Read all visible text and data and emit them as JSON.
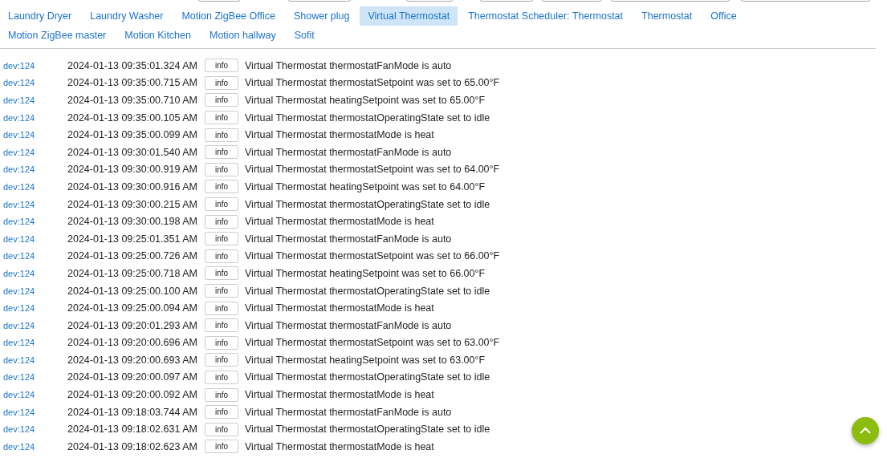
{
  "tabs": [
    {
      "label": "Laundry Dryer",
      "selected": false
    },
    {
      "label": "Laundry Washer",
      "selected": false
    },
    {
      "label": "Motion ZigBee Office",
      "selected": false
    },
    {
      "label": "Shower plug",
      "selected": false
    },
    {
      "label": "Virtual Thermostat",
      "selected": true
    },
    {
      "label": "Thermostat Scheduler: Thermostat",
      "selected": false
    },
    {
      "label": "Thermostat",
      "selected": false
    },
    {
      "label": "Office",
      "selected": false
    },
    {
      "label": "Motion ZigBee master",
      "selected": false
    },
    {
      "label": "Motion Kitchen",
      "selected": false
    },
    {
      "label": "Motion hallway",
      "selected": false
    },
    {
      "label": "Sofit",
      "selected": false
    }
  ],
  "log": [
    {
      "device": "dev:124",
      "time": "2024-01-13 09:35:01.324 AM",
      "level": "info",
      "message": "Virtual Thermostat thermostatFanMode is auto"
    },
    {
      "device": "dev:124",
      "time": "2024-01-13 09:35:00.715 AM",
      "level": "info",
      "message": "Virtual Thermostat thermostatSetpoint was set to 65.00°F"
    },
    {
      "device": "dev:124",
      "time": "2024-01-13 09:35:00.710 AM",
      "level": "info",
      "message": "Virtual Thermostat heatingSetpoint was set to 65.00°F"
    },
    {
      "device": "dev:124",
      "time": "2024-01-13 09:35:00.105 AM",
      "level": "info",
      "message": "Virtual Thermostat thermostatOperatingState set to idle"
    },
    {
      "device": "dev:124",
      "time": "2024-01-13 09:35:00.099 AM",
      "level": "info",
      "message": "Virtual Thermostat thermostatMode is heat"
    },
    {
      "device": "dev:124",
      "time": "2024-01-13 09:30:01.540 AM",
      "level": "info",
      "message": "Virtual Thermostat thermostatFanMode is auto"
    },
    {
      "device": "dev:124",
      "time": "2024-01-13 09:30:00.919 AM",
      "level": "info",
      "message": "Virtual Thermostat thermostatSetpoint was set to 64.00°F"
    },
    {
      "device": "dev:124",
      "time": "2024-01-13 09:30:00.916 AM",
      "level": "info",
      "message": "Virtual Thermostat heatingSetpoint was set to 64.00°F"
    },
    {
      "device": "dev:124",
      "time": "2024-01-13 09:30:00.215 AM",
      "level": "info",
      "message": "Virtual Thermostat thermostatOperatingState set to idle"
    },
    {
      "device": "dev:124",
      "time": "2024-01-13 09:30:00.198 AM",
      "level": "info",
      "message": "Virtual Thermostat thermostatMode is heat"
    },
    {
      "device": "dev:124",
      "time": "2024-01-13 09:25:01.351 AM",
      "level": "info",
      "message": "Virtual Thermostat thermostatFanMode is auto"
    },
    {
      "device": "dev:124",
      "time": "2024-01-13 09:25:00.726 AM",
      "level": "info",
      "message": "Virtual Thermostat thermostatSetpoint was set to 66.00°F"
    },
    {
      "device": "dev:124",
      "time": "2024-01-13 09:25:00.718 AM",
      "level": "info",
      "message": "Virtual Thermostat heatingSetpoint was set to 66.00°F"
    },
    {
      "device": "dev:124",
      "time": "2024-01-13 09:25:00.100 AM",
      "level": "info",
      "message": "Virtual Thermostat thermostatOperatingState set to idle"
    },
    {
      "device": "dev:124",
      "time": "2024-01-13 09:25:00.094 AM",
      "level": "info",
      "message": "Virtual Thermostat thermostatMode is heat"
    },
    {
      "device": "dev:124",
      "time": "2024-01-13 09:20:01.293 AM",
      "level": "info",
      "message": "Virtual Thermostat thermostatFanMode is auto"
    },
    {
      "device": "dev:124",
      "time": "2024-01-13 09:20:00.696 AM",
      "level": "info",
      "message": "Virtual Thermostat thermostatSetpoint was set to 63.00°F"
    },
    {
      "device": "dev:124",
      "time": "2024-01-13 09:20:00.693 AM",
      "level": "info",
      "message": "Virtual Thermostat heatingSetpoint was set to 63.00°F"
    },
    {
      "device": "dev:124",
      "time": "2024-01-13 09:20:00.097 AM",
      "level": "info",
      "message": "Virtual Thermostat thermostatOperatingState set to idle"
    },
    {
      "device": "dev:124",
      "time": "2024-01-13 09:20:00.092 AM",
      "level": "info",
      "message": "Virtual Thermostat thermostatMode is heat"
    },
    {
      "device": "dev:124",
      "time": "2024-01-13 09:18:03.744 AM",
      "level": "info",
      "message": "Virtual Thermostat thermostatFanMode is auto"
    },
    {
      "device": "dev:124",
      "time": "2024-01-13 09:18:02.631 AM",
      "level": "info",
      "message": "Virtual Thermostat thermostatOperatingState set to idle"
    },
    {
      "device": "dev:124",
      "time": "2024-01-13 09:18:02.623 AM",
      "level": "info",
      "message": "Virtual Thermostat thermostatMode is heat"
    }
  ]
}
